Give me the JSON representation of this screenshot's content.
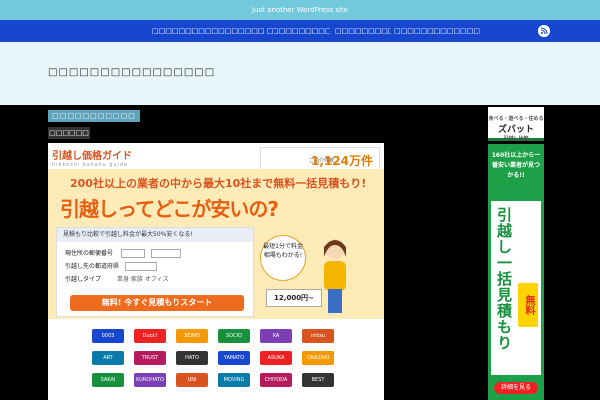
{
  "site": {
    "tagline": "Just another WordPress site",
    "title": "□□□□□□□□□□□□□□□□",
    "tag_label": "□□□□□□□□□□□",
    "post_title": "□□□□□□"
  },
  "nav": {
    "items": [
      {
        "label": "□□□□□□□□□□□□□□□□□ □□□□□□□□□□□□□□"
      },
      {
        "label": "□□□□□□□□□□□□□□"
      },
      {
        "label": "□□□□□□□□□□□□□"
      },
      {
        "label": "□□□□□□□□□□□□□□□□□"
      }
    ],
    "rss_icon": "rss-icon"
  },
  "main_ad": {
    "logo": "引越し価格ガイド",
    "logo_sub": "hikkoshi kakaku guide",
    "count_label": "ご紹介件数",
    "count_value": "1,124万件",
    "count_suffix": "突破!",
    "headline": "200社以上の業者の中から最大10社まで無料一括見積もり!",
    "big_question": "引越しってどこが安いの?",
    "form_banner": "見積もり比較で引越し料金が最大50%安くなる!",
    "row1": "現住所の郵便番号",
    "row2": "引越し先の都道府県",
    "row3": "引越しタイプ",
    "row3_options": "単身  家族  オフィス",
    "cta": "無料! 今すぐ見積もりスタート",
    "bubble": "最短1分で料金相場もわかる!",
    "price": "12,000円~",
    "mover_logos": [
      "0003",
      "Duck!",
      "SEINO",
      "SOCIO",
      "KA",
      "nittsu",
      "ART",
      "TRUST",
      "HATO",
      "YAMATO",
      "ASUKA",
      "OKAZAKI",
      "SAKAI",
      "KUROHATO",
      "UNI",
      "MOVING",
      "CHIYODA",
      "BEST"
    ]
  },
  "side_ad": {
    "brand_top": "食べる・遊べる・住める",
    "brand": "ズバット",
    "brand_sub": "引越し比較",
    "lead": "160社以上から一番安い業者が見つかる!!",
    "vertical": "引越し一括見積もり",
    "free": "無料",
    "more": "詳細を見る"
  },
  "colors": {
    "tagline_bg": "#74c8dc",
    "nav_bg": "#1747cf",
    "header_bg": "#e8f6fa",
    "accent_orange": "#e85e10",
    "side_green": "#1ea048"
  }
}
